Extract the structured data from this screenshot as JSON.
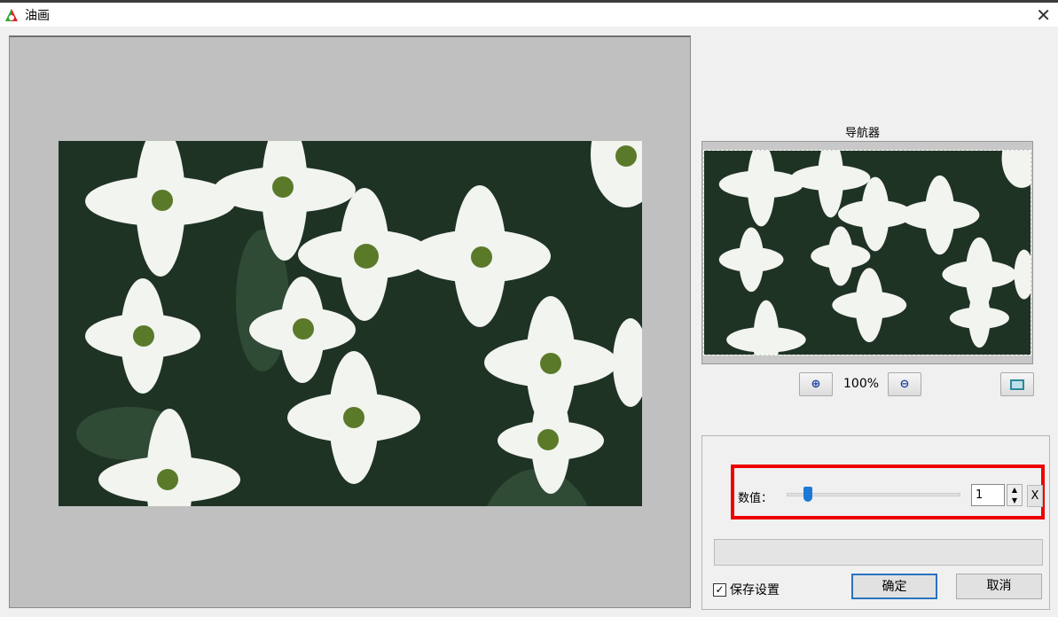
{
  "window": {
    "title": "油画",
    "close_icon": "close-icon"
  },
  "navigator": {
    "label": "导航器",
    "zoom": "100%"
  },
  "controls": {
    "value_label": "数值：",
    "value": "1",
    "slider_min": 1,
    "slider_max": 10,
    "slider_value": 1,
    "reset_label": "X"
  },
  "footer": {
    "save_settings": "保存设置",
    "save_checked": true,
    "ok": "确定",
    "cancel": "取消"
  },
  "colors": {
    "highlight": "#e00000",
    "accent": "#1e78d6"
  }
}
